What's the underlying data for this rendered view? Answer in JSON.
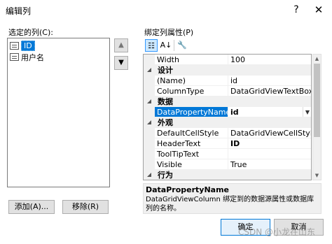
{
  "window": {
    "title": "编辑列",
    "help": "?",
    "close": "✕"
  },
  "left": {
    "label": "选定的列(C):",
    "columns": [
      {
        "label": "ID",
        "selected": true
      },
      {
        "label": "用户名",
        "selected": false
      }
    ],
    "move_up": "▲",
    "move_down": "▼",
    "add_button": "添加(A)...",
    "remove_button": "移除(R)"
  },
  "right": {
    "label": "绑定列属性(P)",
    "toolbar": {
      "categorized": "☷",
      "alphabetical": "A↓",
      "property_pages": "🔧"
    },
    "rows": [
      {
        "kind": "prop",
        "name": "Width",
        "value": "100"
      },
      {
        "kind": "cat",
        "name": "设计"
      },
      {
        "kind": "prop",
        "name": "(Name)",
        "value": "id"
      },
      {
        "kind": "prop",
        "name": "ColumnType",
        "value": "DataGridViewTextBoxColu"
      },
      {
        "kind": "cat",
        "name": "数据"
      },
      {
        "kind": "prop",
        "name": "DataPropertyName",
        "value": "id",
        "selected": true,
        "bold": true,
        "dropdown": true
      },
      {
        "kind": "cat",
        "name": "外观"
      },
      {
        "kind": "prop",
        "name": "DefaultCellStyle",
        "value": "DataGridViewCellStyle { }"
      },
      {
        "kind": "prop",
        "name": "HeaderText",
        "value": "ID",
        "bold": true
      },
      {
        "kind": "prop",
        "name": "ToolTipText",
        "value": ""
      },
      {
        "kind": "prop",
        "name": "Visible",
        "value": "True"
      },
      {
        "kind": "cat",
        "name": "行为"
      }
    ],
    "description": {
      "title": "DataPropertyName",
      "text": "DataGridViewColumn 绑定到的数据源属性或数据库列的名称。"
    }
  },
  "buttons": {
    "ok": "确定",
    "cancel": "取消"
  },
  "watermark": "CSDN @小龙在山东"
}
